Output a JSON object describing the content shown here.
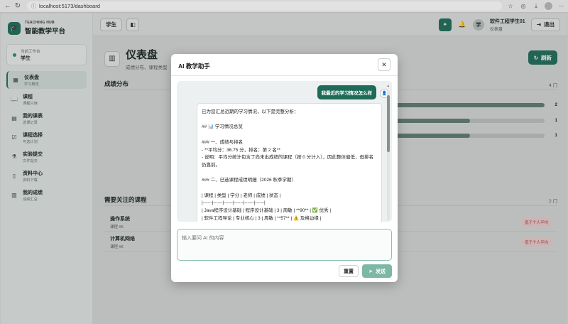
{
  "browser": {
    "url": "localhost:5173/dashboard",
    "back_icon": "back-arrow-icon",
    "reload_icon": "reload-icon"
  },
  "sidebar": {
    "brand_sub": "TEACHING HUB",
    "brand_title": "智能教学平台",
    "workspace_label": "当前工作台",
    "workspace_value": "学生",
    "items": [
      {
        "title": "仪表盘",
        "sub": "学习概览",
        "icon": "dashboard-icon"
      },
      {
        "title": "课程",
        "sub": "课程只读",
        "icon": "book-icon"
      },
      {
        "title": "我的课表",
        "sub": "选课记录",
        "icon": "clipboard-icon"
      },
      {
        "title": "课程选择",
        "sub": "可选计划",
        "icon": "checklist-icon"
      },
      {
        "title": "实验提交",
        "sub": "文件提交",
        "icon": "flask-icon"
      },
      {
        "title": "资料中心",
        "sub": "资料下载",
        "icon": "document-icon"
      },
      {
        "title": "我的成绩",
        "sub": "成绩汇总",
        "icon": "chart-icon"
      }
    ]
  },
  "topbar": {
    "role_button": "学生",
    "user_avatar": "学",
    "user_name": "软件工程学生01",
    "user_role": "仪表盘",
    "logout_label": "退出"
  },
  "page": {
    "title": "仪表盘",
    "subtitle": "成绩分布、课程类型",
    "refresh_label": "刷新"
  },
  "distribution": {
    "title": "成绩分布",
    "count": "4 门",
    "rows": [
      {
        "value": "2",
        "fraction": 1.0
      },
      {
        "value": "1",
        "fraction": 0.5
      },
      {
        "value": "1",
        "fraction": 0.5
      }
    ]
  },
  "attention": {
    "title": "需要关注的课程",
    "count": "2 门",
    "courses": [
      {
        "name": "操作系统",
        "meta": "课程 #5",
        "badge": "低于个人平均"
      },
      {
        "name": "计算机网络",
        "meta": "课程 #6",
        "badge": "低于个人平均"
      }
    ]
  },
  "modal": {
    "title": "AI 教学助手",
    "user_message": "我最近的学习情况怎么样",
    "ai_message": "已为您汇总近期的学习情况，以下是完整分析：\n\n## 📊 学习情况总览\n\n### 一、成绩与排名\n- **平均分：36.75 分，排名：第 2 名**\n- 说明：平均分统计包含了尚未出成绩的课程（按 0 分计入），因此整体偏低，但排名\n仍靠前。\n\n### 二、已选课程成绩明细（2026 秋季学期）\n\n| 课程 | 类型 | 学分 | 老师 | 成绩 | 状态 |\n|------|------|------|------|------|------|\n| Java程序设计基础 | 程序设计基础 | 3 | 周敏 | **90** | ✅ 优秀 |\n| 软件工程导论 | 专业核心 | 3 | 周敏 | **57** | ⚠️ 及格边缘 |",
    "input_placeholder": "输入要问 AI 的内容",
    "reset_label": "重置",
    "send_label": "发送"
  }
}
